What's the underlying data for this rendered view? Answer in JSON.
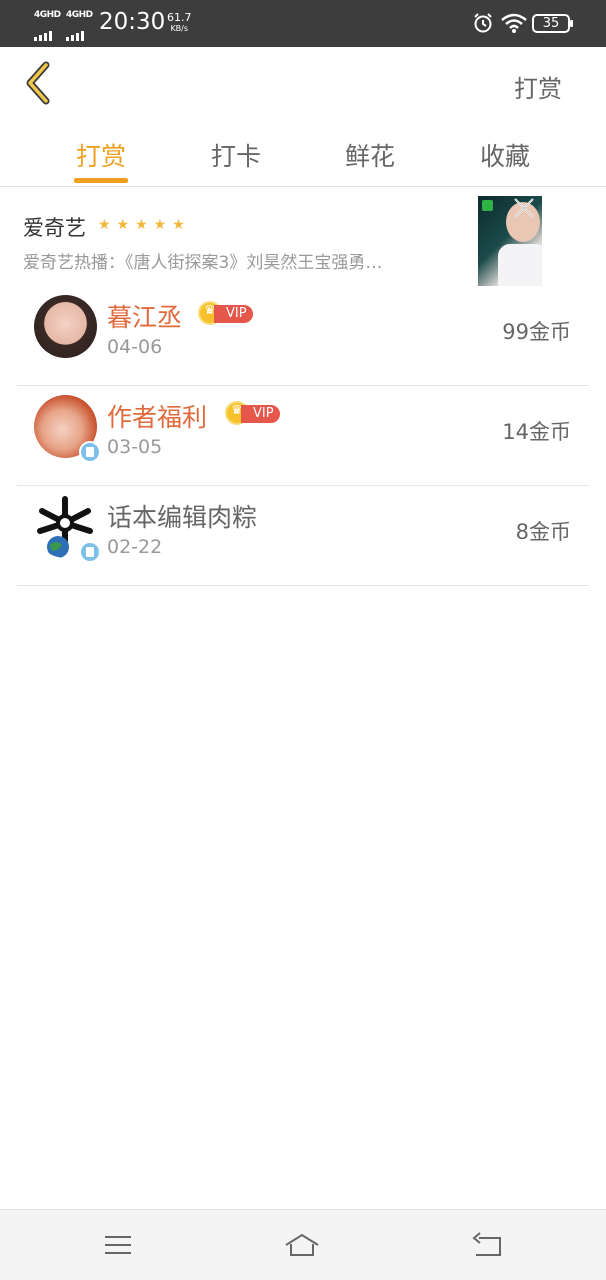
{
  "status_bar": {
    "sim1": "4GHD",
    "sim2": "4GHD",
    "time": "20:30",
    "speed_value": "61.7",
    "speed_unit": "KB/s",
    "battery": "35"
  },
  "header": {
    "back_icon": "chevron-left-icon",
    "title": "打赏"
  },
  "tabs": [
    {
      "label": "打赏",
      "active": true
    },
    {
      "label": "打卡",
      "active": false
    },
    {
      "label": "鲜花",
      "active": false
    },
    {
      "label": "收藏",
      "active": false
    }
  ],
  "ad": {
    "title": "爱奇艺",
    "stars": "★★★★★",
    "description": "爱奇艺热播：《唐人街探案3》刘昊然王宝强勇…"
  },
  "rewards": [
    {
      "name": "暮江丞",
      "vip": "VIP",
      "date": "04-06",
      "amount": "99金币"
    },
    {
      "name": "作者福利",
      "vip": "VIP",
      "date": "03-05",
      "amount": "14金币"
    },
    {
      "name": "话本编辑肉粽",
      "vip": "",
      "date": "02-22",
      "amount": "8金币"
    }
  ],
  "colors": {
    "accent": "#f0a020",
    "name_highlight": "#e06a3c",
    "vip_tag": "#e4574a",
    "status_bar": "#3d3d3d"
  }
}
